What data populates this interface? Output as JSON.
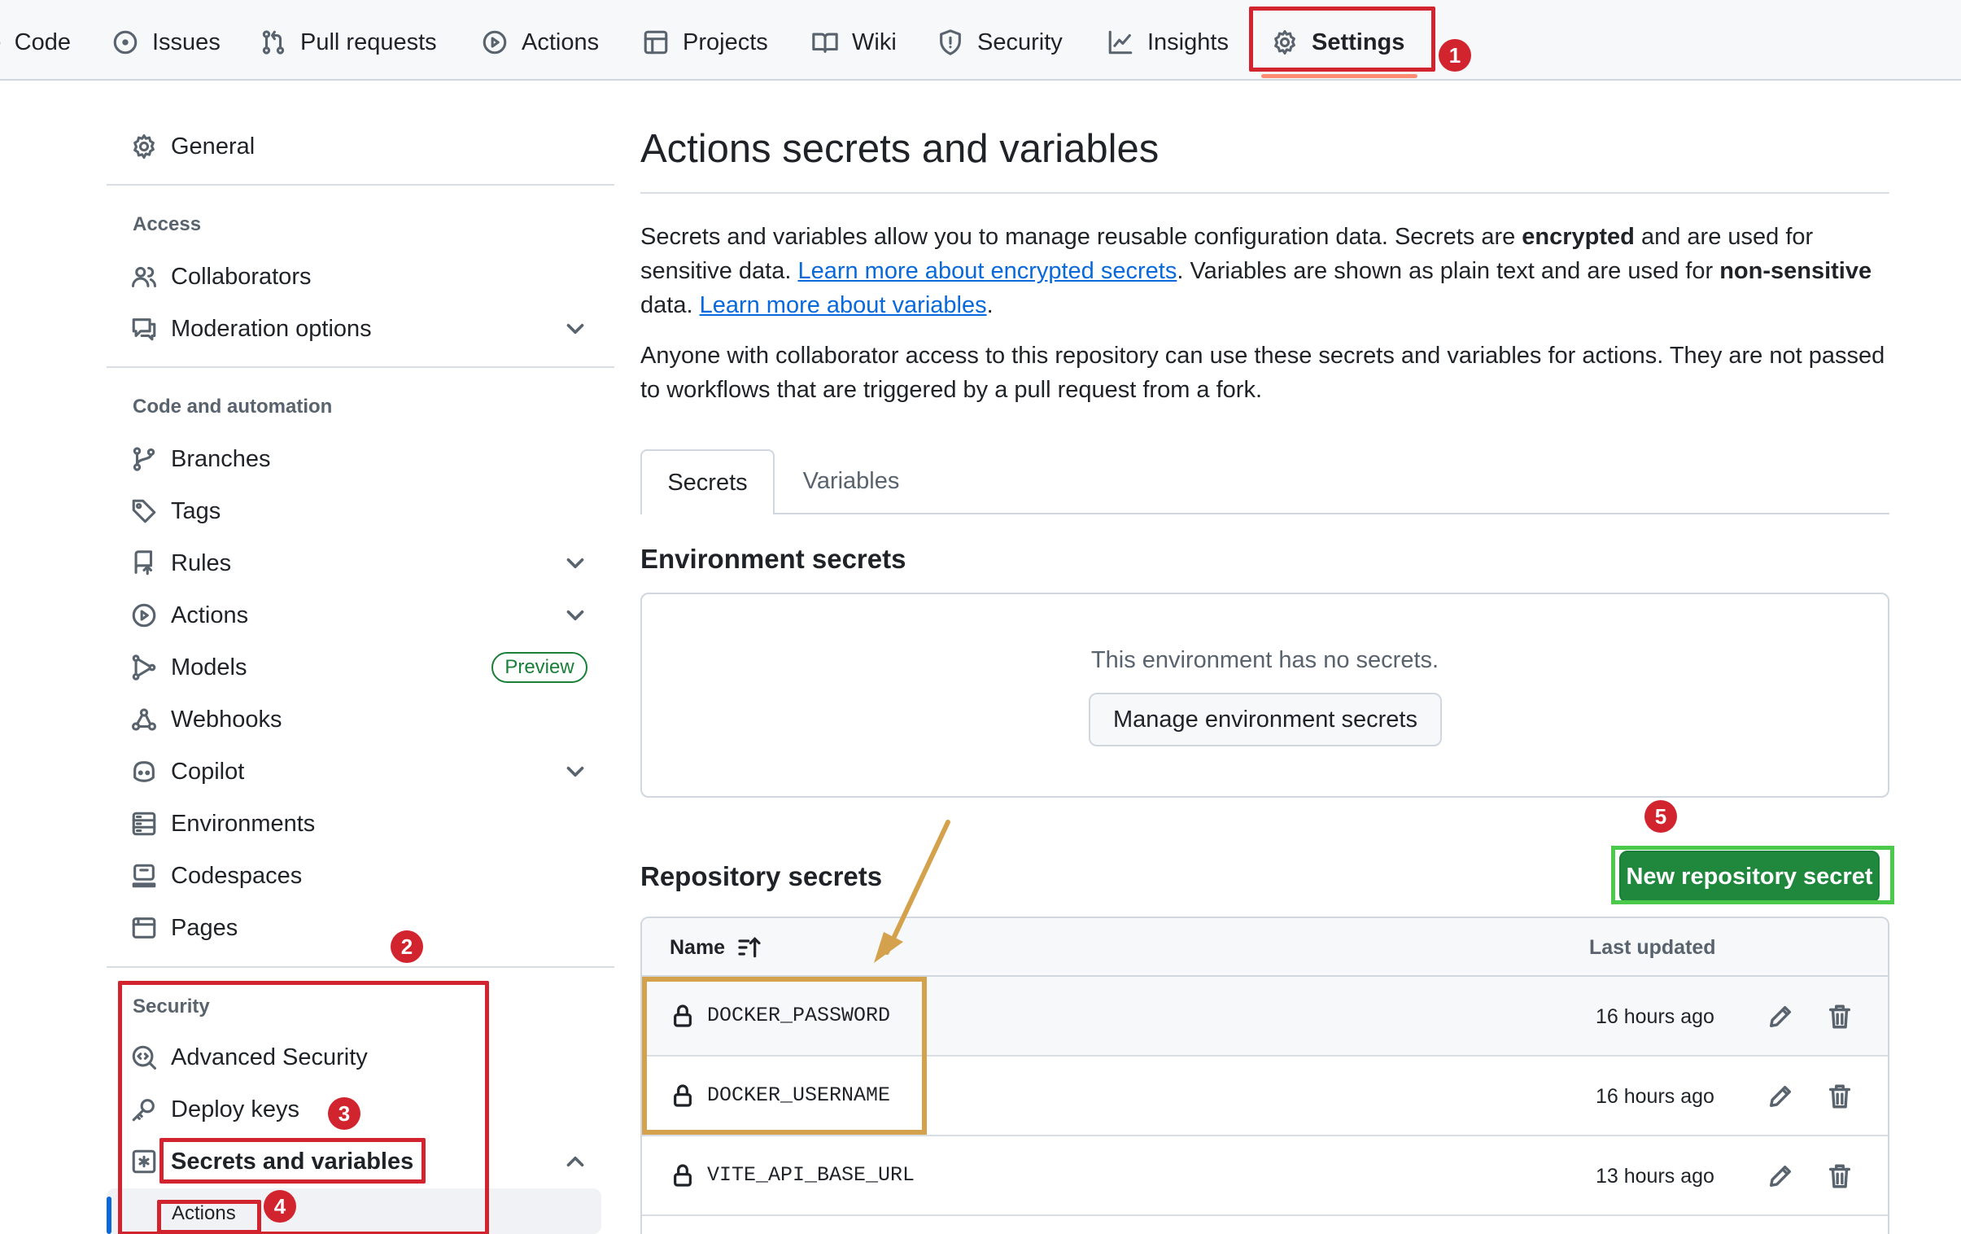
{
  "top_nav": {
    "tabs": [
      {
        "label": "Code",
        "icon": "code-icon"
      },
      {
        "label": "Issues",
        "icon": "issue-opened-icon"
      },
      {
        "label": "Pull requests",
        "icon": "git-pull-request-icon"
      },
      {
        "label": "Actions",
        "icon": "play-icon"
      },
      {
        "label": "Projects",
        "icon": "table-icon"
      },
      {
        "label": "Wiki",
        "icon": "book-icon"
      },
      {
        "label": "Security",
        "icon": "shield-icon"
      },
      {
        "label": "Insights",
        "icon": "graph-icon"
      },
      {
        "label": "Settings",
        "icon": "gear-icon",
        "active": true
      }
    ]
  },
  "sidebar": {
    "general": "General",
    "sections": {
      "access": "Access",
      "code_automation": "Code and automation",
      "security": "Security"
    },
    "items": {
      "collaborators": "Collaborators",
      "moderation": "Moderation options",
      "branches": "Branches",
      "tags": "Tags",
      "rules": "Rules",
      "actions": "Actions",
      "models": "Models",
      "models_badge": "Preview",
      "webhooks": "Webhooks",
      "copilot": "Copilot",
      "environments": "Environments",
      "codespaces": "Codespaces",
      "pages": "Pages",
      "advanced_security": "Advanced Security",
      "deploy_keys": "Deploy keys",
      "secrets_variables": "Secrets and variables",
      "sub_actions": "Actions"
    }
  },
  "main": {
    "title": "Actions secrets and variables",
    "intro": {
      "p1_a": "Secrets and variables allow you to manage reusable configuration data. Secrets are ",
      "p1_b": "encrypted",
      "p1_c": " and are used for sensitive data. ",
      "p1_link1": "Learn more about encrypted secrets",
      "p1_d": ". Variables are shown as plain text and are used for ",
      "p1_e": "non-sensitive",
      "p1_f": " data. ",
      "p1_link2": "Learn more about variables",
      "p1_g": ".",
      "p2": "Anyone with collaborator access to this repository can use these secrets and variables for actions. They are not passed to workflows that are triggered by a pull request from a fork."
    },
    "tabs": {
      "secrets": "Secrets",
      "variables": "Variables"
    },
    "env_secrets": {
      "heading": "Environment secrets",
      "empty": "This environment has no secrets.",
      "manage_button": "Manage environment secrets"
    },
    "repo_secrets": {
      "heading": "Repository secrets",
      "new_button": "New repository secret",
      "col_name": "Name",
      "col_updated": "Last updated",
      "rows": [
        {
          "name": "DOCKER_PASSWORD",
          "updated": "16 hours ago"
        },
        {
          "name": "DOCKER_USERNAME",
          "updated": "16 hours ago"
        },
        {
          "name": "VITE_API_BASE_URL",
          "updated": "13 hours ago"
        }
      ]
    }
  },
  "annotations": {
    "badges": [
      "1",
      "2",
      "3",
      "4",
      "5"
    ],
    "colors": {
      "red": "#d1242f",
      "gold": "#d4a24c",
      "green": "#4ac94a"
    }
  }
}
